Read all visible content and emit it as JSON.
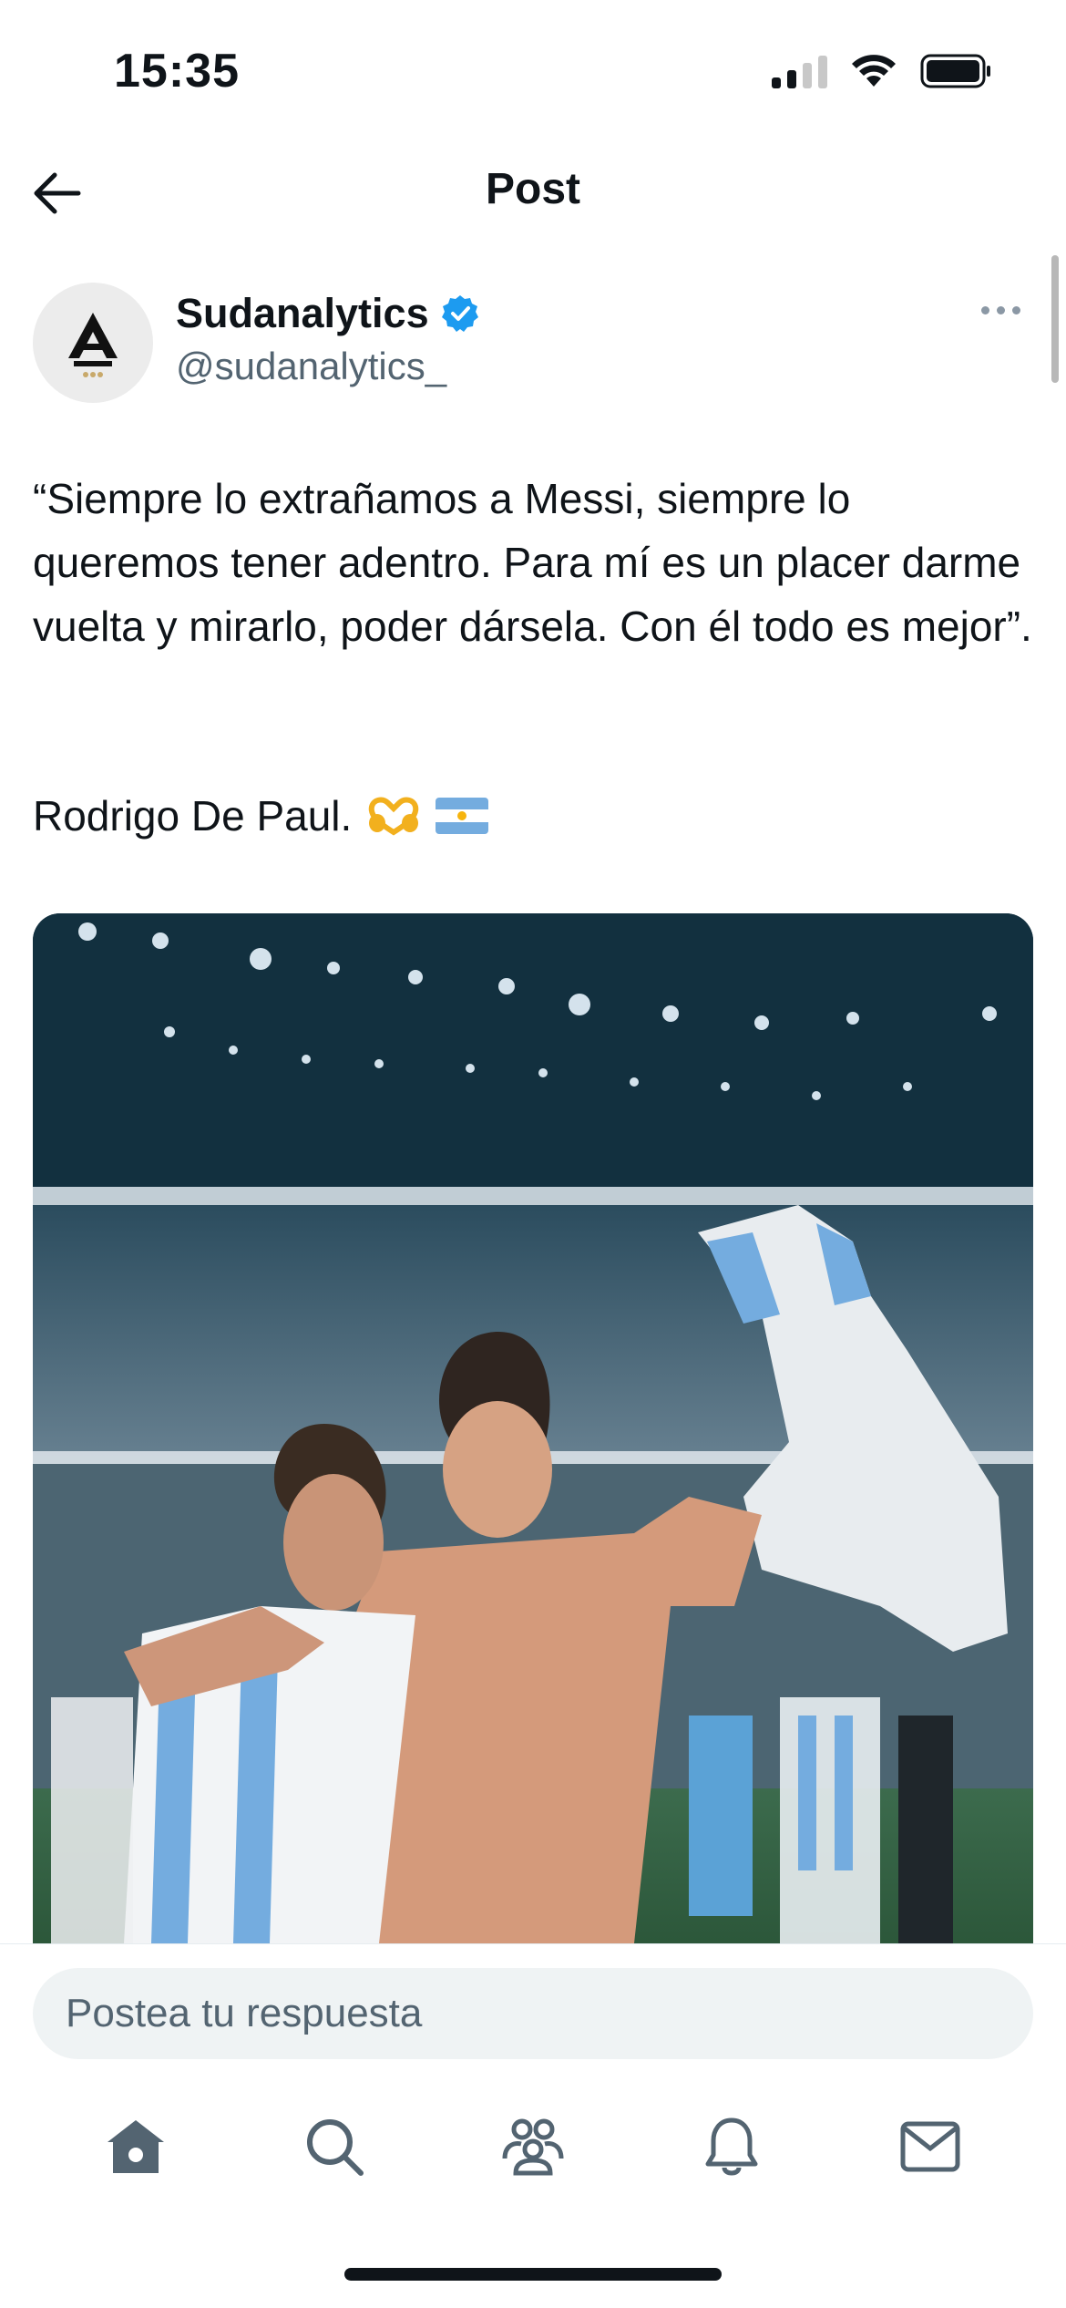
{
  "status_bar": {
    "time": "15:35",
    "icons": [
      "cellular-signal-icon",
      "wifi-icon",
      "battery-icon"
    ]
  },
  "header": {
    "title": "Post",
    "back_icon": "back-arrow-icon"
  },
  "author": {
    "name": "Sudanalytics",
    "handle": "@sudanalytics_",
    "verified": true,
    "avatar_icon": "sudanalytics-logo"
  },
  "post": {
    "text": "“Siempre lo extrañamos a Messi, siempre lo queremos tener adentro. Para mí es un placer darme vuelta y mirarlo, poder dársela. Con él todo es mejor”.",
    "signature": "Rodrigo De Paul.",
    "emojis": [
      "heart-hands-emoji",
      "argentina-flag-emoji"
    ]
  },
  "reply": {
    "placeholder": "Postea tu respuesta"
  },
  "nav": {
    "items": [
      "home-icon",
      "search-icon",
      "communities-icon",
      "notifications-icon",
      "messages-icon"
    ]
  },
  "colors": {
    "accent": "#1d9bf0",
    "text": "#0f1419",
    "secondary": "#536471",
    "input_bg": "#eff3f4"
  }
}
